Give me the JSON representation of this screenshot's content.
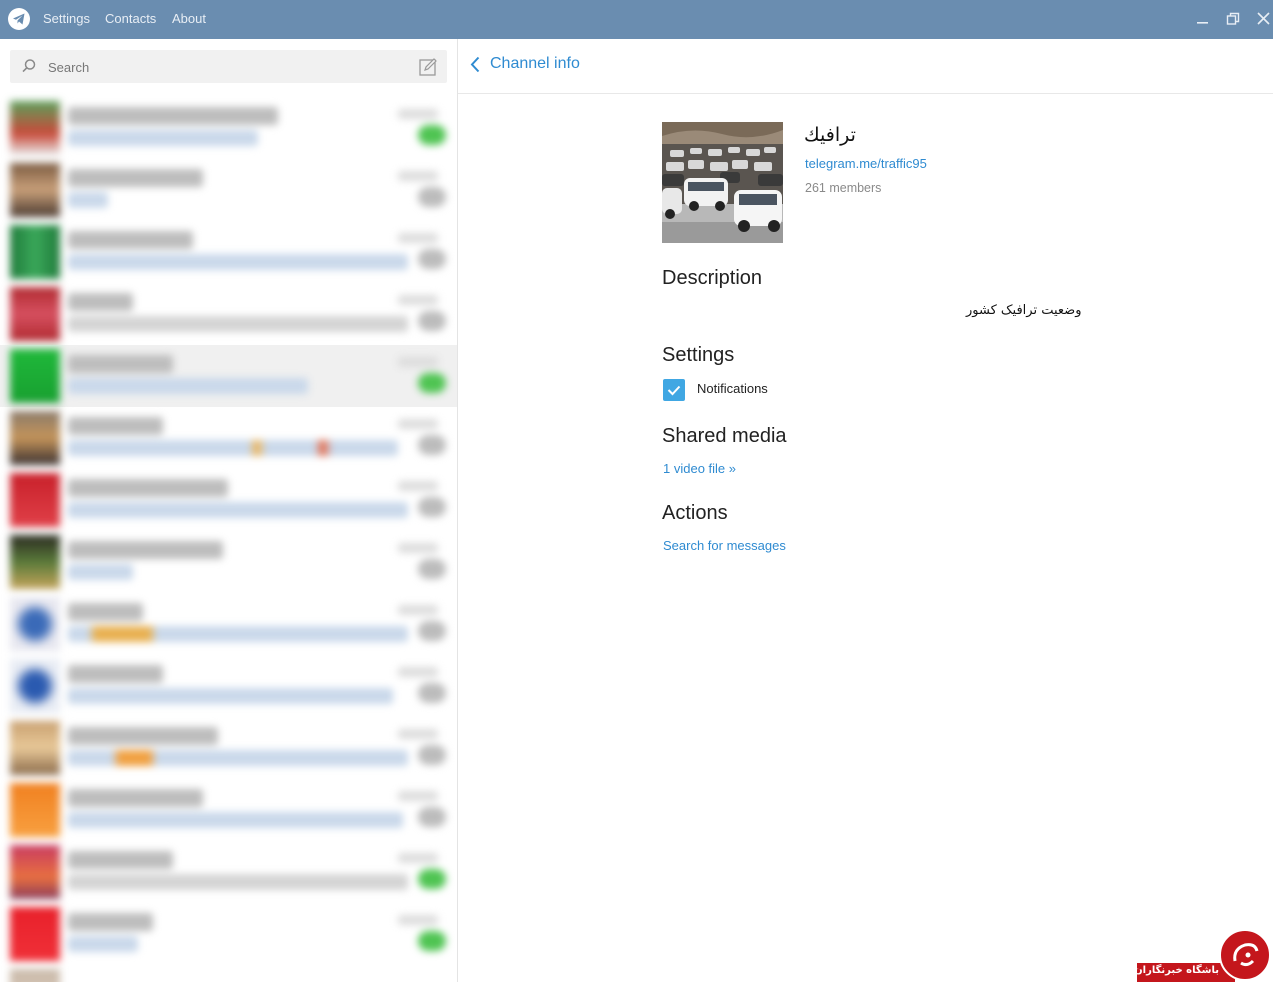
{
  "titlebar": {
    "menu": [
      "Settings",
      "Contacts",
      "About"
    ],
    "controls": [
      "minimize-icon",
      "restore-icon",
      "close-icon"
    ],
    "color": "#6a8db0"
  },
  "search": {
    "placeholder": "Search"
  },
  "chat_list": {
    "count": 15,
    "selected_index": 4
  },
  "header": {
    "back_label": "Channel info"
  },
  "channel": {
    "name": "ترافيك",
    "link": "telegram.me/traffic95",
    "members": "261 members"
  },
  "sections": {
    "description_title": "Description",
    "description_text": "وضعیت ترافیک کشور",
    "settings_title": "Settings",
    "notifications_label": "Notifications",
    "notifications_checked": true,
    "shared_media_title": "Shared media",
    "shared_media_link": "1 video file »",
    "actions_title": "Actions",
    "search_messages_link": "Search for messages"
  },
  "watermark": {
    "text": "باشگاه خبرنگاران"
  },
  "colors": {
    "accent": "#2f8bd1",
    "checkbox": "#40a7e3",
    "unread_badge": "#4fc452",
    "watermark_red": "#c4161c"
  }
}
